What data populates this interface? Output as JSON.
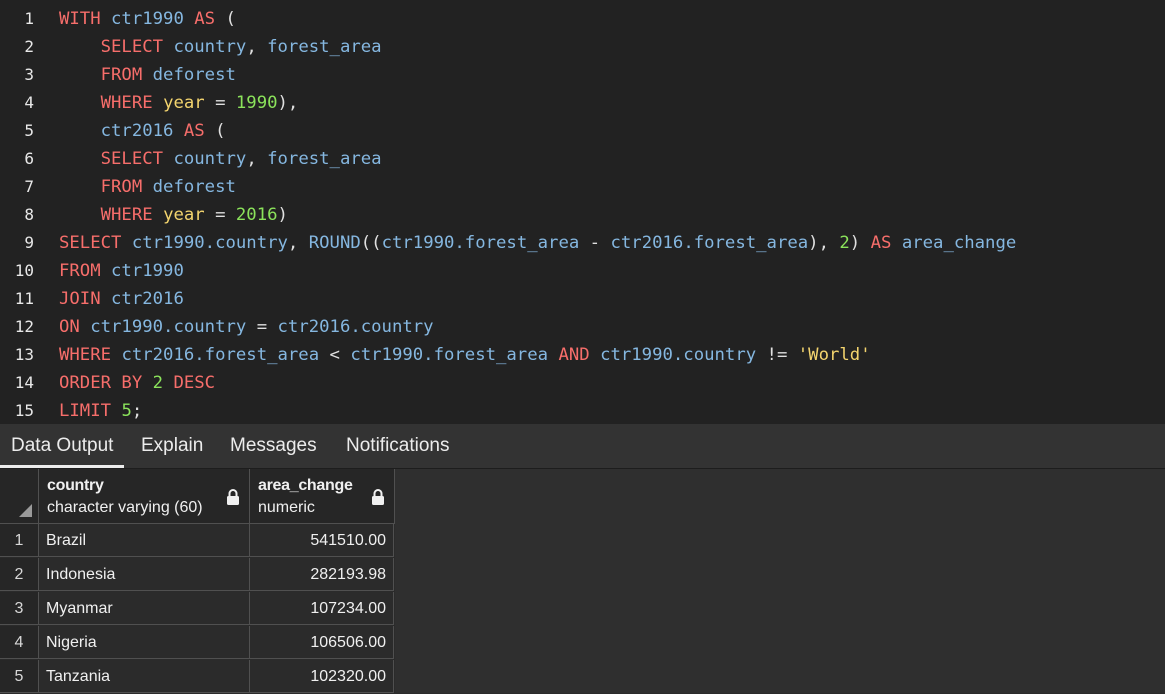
{
  "editor": {
    "lines": [
      {
        "n": "1",
        "t": [
          [
            "kw",
            "WITH "
          ],
          [
            "id",
            "ctr1990 "
          ],
          [
            "kw",
            "AS "
          ],
          [
            "p",
            "("
          ]
        ]
      },
      {
        "n": "2",
        "t": [
          [
            "p",
            "    "
          ],
          [
            "kw",
            "SELECT "
          ],
          [
            "id",
            "country"
          ],
          [
            "p",
            ", "
          ],
          [
            "id",
            "forest_area"
          ]
        ]
      },
      {
        "n": "3",
        "t": [
          [
            "p",
            "    "
          ],
          [
            "kw",
            "FROM "
          ],
          [
            "id",
            "deforest"
          ]
        ]
      },
      {
        "n": "4",
        "t": [
          [
            "p",
            "    "
          ],
          [
            "kw",
            "WHERE "
          ],
          [
            "wt",
            "year"
          ],
          [
            "p",
            " = "
          ],
          [
            "num",
            "1990"
          ],
          [
            "p",
            "),"
          ]
        ]
      },
      {
        "n": "5",
        "t": [
          [
            "p",
            "    "
          ],
          [
            "id",
            "ctr2016 "
          ],
          [
            "kw",
            "AS "
          ],
          [
            "p",
            "("
          ]
        ]
      },
      {
        "n": "6",
        "t": [
          [
            "p",
            "    "
          ],
          [
            "kw",
            "SELECT "
          ],
          [
            "id",
            "country"
          ],
          [
            "p",
            ", "
          ],
          [
            "id",
            "forest_area"
          ]
        ]
      },
      {
        "n": "7",
        "t": [
          [
            "p",
            "    "
          ],
          [
            "kw",
            "FROM "
          ],
          [
            "id",
            "deforest"
          ]
        ]
      },
      {
        "n": "8",
        "t": [
          [
            "p",
            "    "
          ],
          [
            "kw",
            "WHERE "
          ],
          [
            "wt",
            "year"
          ],
          [
            "p",
            " = "
          ],
          [
            "num",
            "2016"
          ],
          [
            "p",
            ")"
          ]
        ]
      },
      {
        "n": "9",
        "t": [
          [
            "kw",
            "SELECT "
          ],
          [
            "id",
            "ctr1990.country"
          ],
          [
            "p",
            ", "
          ],
          [
            "id",
            "ROUND"
          ],
          [
            "p",
            "(("
          ],
          [
            "id",
            "ctr1990.forest_area"
          ],
          [
            "p",
            " - "
          ],
          [
            "id",
            "ctr2016.forest_area"
          ],
          [
            "p",
            "), "
          ],
          [
            "num",
            "2"
          ],
          [
            "p",
            ") "
          ],
          [
            "kw",
            "AS "
          ],
          [
            "id",
            "area_change"
          ]
        ]
      },
      {
        "n": "10",
        "t": [
          [
            "kw",
            "FROM "
          ],
          [
            "id",
            "ctr1990"
          ]
        ]
      },
      {
        "n": "11",
        "t": [
          [
            "kw",
            "JOIN "
          ],
          [
            "id",
            "ctr2016"
          ]
        ]
      },
      {
        "n": "12",
        "t": [
          [
            "kw",
            "ON "
          ],
          [
            "id",
            "ctr1990.country"
          ],
          [
            "p",
            " = "
          ],
          [
            "id",
            "ctr2016.country"
          ]
        ]
      },
      {
        "n": "13",
        "t": [
          [
            "kw",
            "WHERE "
          ],
          [
            "id",
            "ctr2016.forest_area"
          ],
          [
            "p",
            " < "
          ],
          [
            "id",
            "ctr1990.forest_area "
          ],
          [
            "kw",
            "AND "
          ],
          [
            "id",
            "ctr1990.country"
          ],
          [
            "p",
            " != "
          ],
          [
            "str",
            "'World'"
          ]
        ]
      },
      {
        "n": "14",
        "t": [
          [
            "kw",
            "ORDER BY "
          ],
          [
            "num",
            "2 "
          ],
          [
            "kw",
            "DESC"
          ]
        ]
      },
      {
        "n": "15",
        "t": [
          [
            "kw",
            "LIMIT "
          ],
          [
            "num",
            "5"
          ],
          [
            "p",
            ";"
          ]
        ]
      }
    ]
  },
  "tabs": [
    "Data Output",
    "Explain",
    "Messages",
    "Notifications"
  ],
  "active_tab": "Data Output",
  "grid": {
    "columns": [
      {
        "name": "country",
        "type": "character varying (60)"
      },
      {
        "name": "area_change",
        "type": "numeric"
      }
    ],
    "rows": [
      {
        "n": "1",
        "country": "Brazil",
        "area_change": "541510.00"
      },
      {
        "n": "2",
        "country": "Indonesia",
        "area_change": "282193.98"
      },
      {
        "n": "3",
        "country": "Myanmar",
        "area_change": "107234.00"
      },
      {
        "n": "4",
        "country": "Nigeria",
        "area_change": "106506.00"
      },
      {
        "n": "5",
        "country": "Tanzania",
        "area_change": "102320.00"
      }
    ]
  }
}
